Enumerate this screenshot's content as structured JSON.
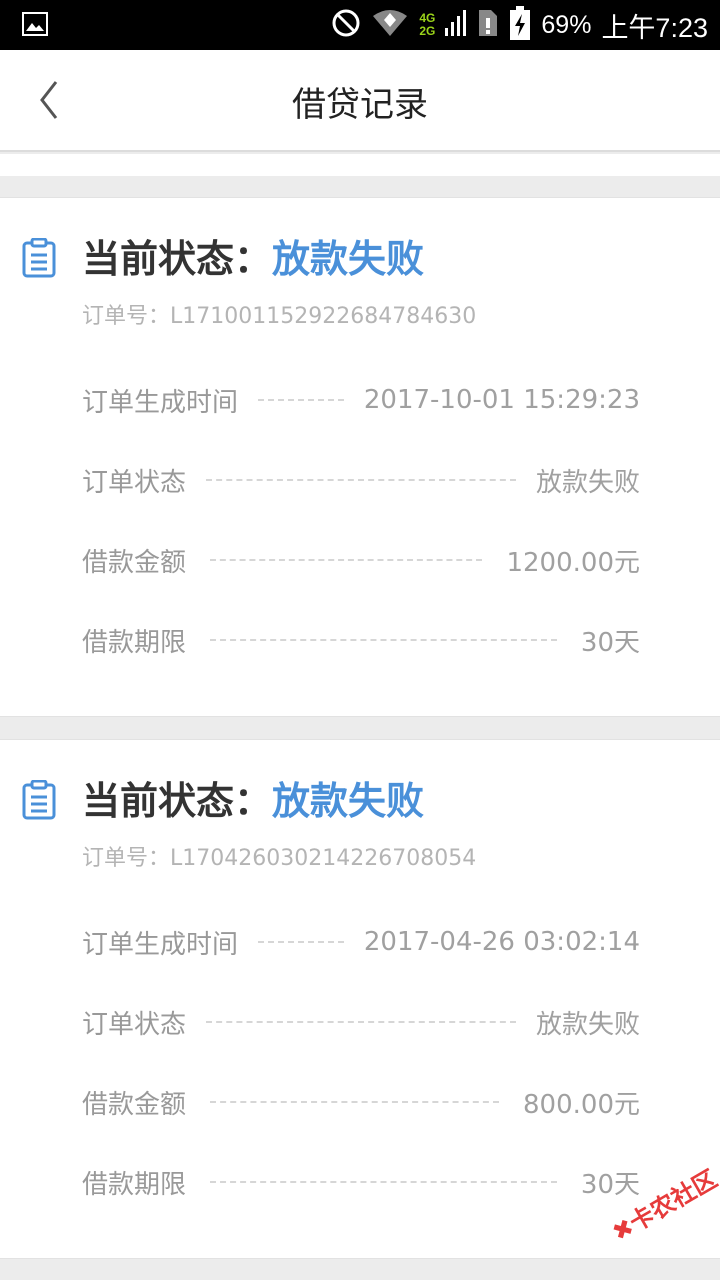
{
  "status_bar": {
    "battery": "69%",
    "time": "上午7:23",
    "net_top": "4G",
    "net_bottom": "2G"
  },
  "nav": {
    "title": "借贷记录"
  },
  "records": [
    {
      "state_label": "当前状态：",
      "state_value": "放款失败",
      "order_no": "订单号：L171001152922684784630",
      "rows": [
        {
          "label": "订单生成时间",
          "value": "2017-10-01 15:29:23"
        },
        {
          "label": "订单状态",
          "value": "放款失败"
        },
        {
          "label": "借款金额",
          "value": "1200.00元"
        },
        {
          "label": "借款期限",
          "value": "30天"
        }
      ]
    },
    {
      "state_label": "当前状态：",
      "state_value": "放款失败",
      "order_no": "订单号：L170426030214226708054",
      "rows": [
        {
          "label": "订单生成时间",
          "value": "2017-04-26 03:02:14"
        },
        {
          "label": "订单状态",
          "value": "放款失败"
        },
        {
          "label": "借款金额",
          "value": "800.00元"
        },
        {
          "label": "借款期限",
          "value": "30天"
        }
      ]
    }
  ],
  "watermark": {
    "text": "卡农社区"
  },
  "colors": {
    "accent": "#4a90d9",
    "status_bar": "#000000",
    "background": "#ececec"
  }
}
